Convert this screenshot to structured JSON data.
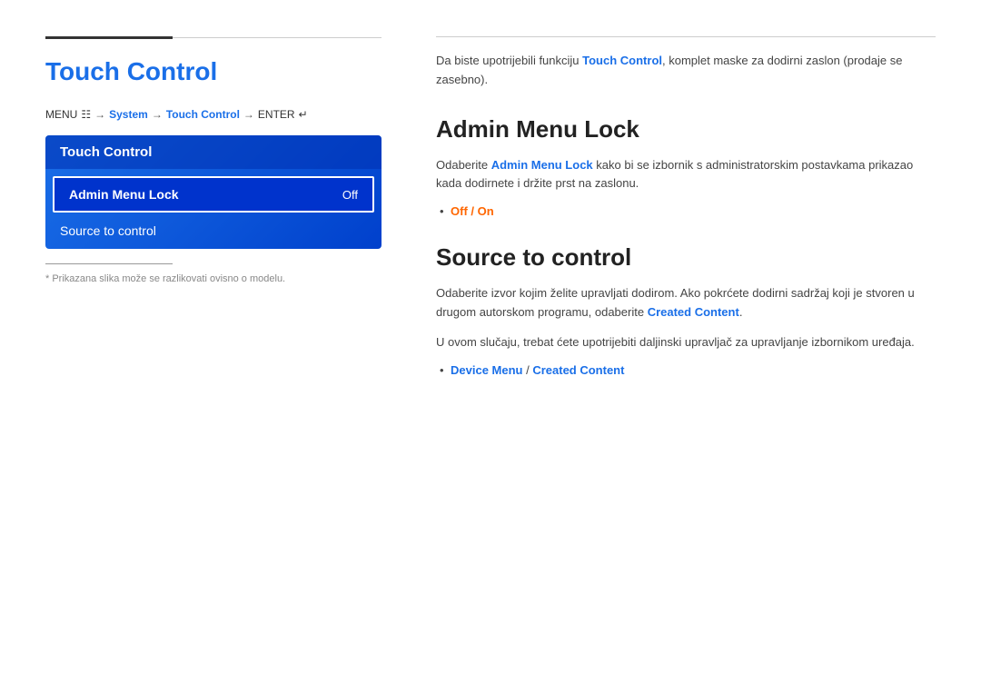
{
  "left": {
    "pageTitle": "Touch Control",
    "menuPath": {
      "menu": "MENU",
      "menuIcon": "☰",
      "arrow1": "→",
      "system": "System",
      "arrow2": "→",
      "touchControl": "Touch Control",
      "arrow3": "→",
      "enter": "ENTER",
      "enterIcon": "↵"
    },
    "menuBox": {
      "header": "Touch Control",
      "items": [
        {
          "label": "Admin Menu Lock",
          "value": "Off",
          "active": true
        },
        {
          "label": "Source to control",
          "value": "",
          "active": false
        }
      ]
    },
    "noteText": "* Prikazana slika može se razlikovati ovisno o modelu."
  },
  "right": {
    "introText": "Da biste upotrijebili funkciju ",
    "introHighlight": "Touch Control",
    "introTextEnd": ", komplet maske za dodirni zaslon (prodaje se zasebno).",
    "sections": [
      {
        "id": "admin-menu-lock",
        "title": "Admin Menu Lock",
        "description": "Odaberite ",
        "descriptionHighlight": "Admin Menu Lock",
        "descriptionEnd": " kako bi se izbornik s administratorskim postavkama prikazao kada dodirnete i držite prst na zaslonu.",
        "bullets": [
          {
            "text": "Off / On",
            "type": "orange"
          }
        ]
      },
      {
        "id": "source-to-control",
        "title": "Source to control",
        "description1": "Odaberite izvor kojim želite upravljati dodirom. Ako pokrćete dodirni sadržaj koji je stvoren u drugom autorskom programu, odaberite ",
        "description1Highlight": "Created Content",
        "description1End": ".",
        "description2": "U ovom slučaju, trebat ćete upotrijebiti daljinski upravljač za upravljanje izbornikom uređaja.",
        "bullets": [
          {
            "text1": "Device Menu",
            "separator": " / ",
            "text2": "Created Content",
            "type": "blue"
          }
        ]
      }
    ]
  }
}
